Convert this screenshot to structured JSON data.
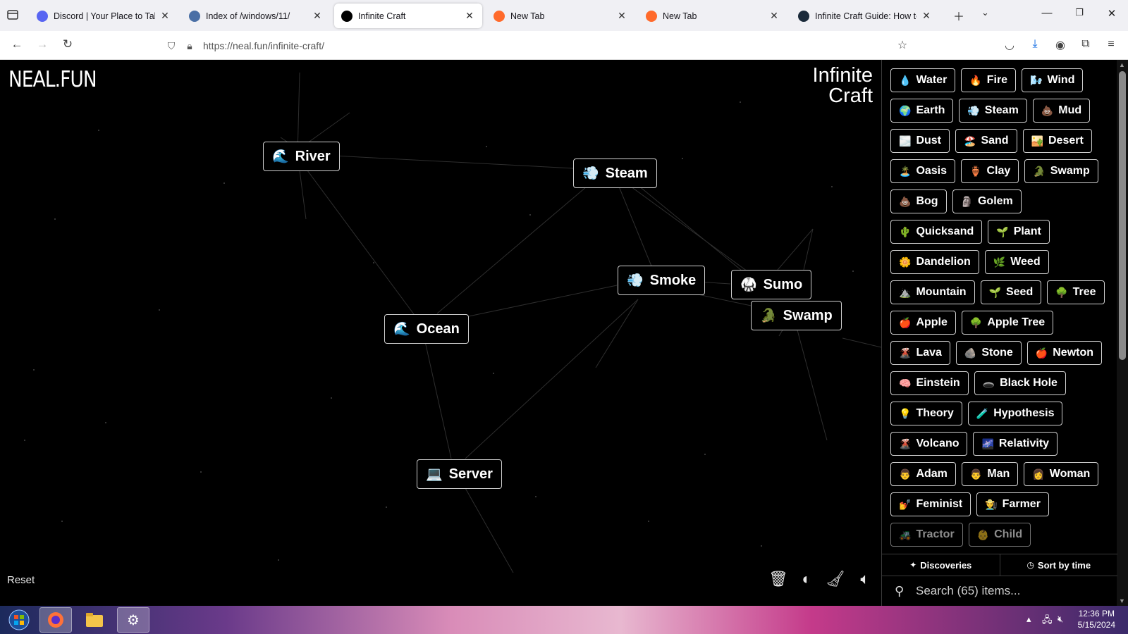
{
  "browser": {
    "tabs": [
      {
        "title": "Discord | Your Place to Talk and",
        "favicon": "discord-icon",
        "color": "#5865f2",
        "active": false
      },
      {
        "title": "Index of /windows/11/",
        "favicon": "page-icon",
        "color": "#4a6fa5",
        "active": false
      },
      {
        "title": "Infinite Craft",
        "favicon": "infinity-icon",
        "color": "#000000",
        "active": true
      },
      {
        "title": "New Tab",
        "favicon": "firefox-icon",
        "color": "#ff6a2b",
        "active": false
      },
      {
        "title": "New Tab",
        "favicon": "firefox-icon",
        "color": "#ff6a2b",
        "active": false
      },
      {
        "title": "Infinite Craft Guide: How to Make",
        "favicon": "article-icon",
        "color": "#1a2a3a",
        "active": false
      }
    ],
    "url": "https://neal.fun/infinite-craft/"
  },
  "canvas": {
    "logo": "NEAL.FUN",
    "brand_line1": "Infinite",
    "brand_line2": "Craft",
    "reset_label": "Reset",
    "nodes": [
      {
        "emoji": "🌊",
        "label": "River"
      },
      {
        "emoji": "💨",
        "label": "Steam"
      },
      {
        "emoji": "💨",
        "label": "Smoke"
      },
      {
        "emoji": "🥋",
        "label": "Sumo"
      },
      {
        "emoji": "🐊",
        "label": "Swamp"
      },
      {
        "emoji": "🌊",
        "label": "Ocean"
      },
      {
        "emoji": "💻",
        "label": "Server"
      }
    ]
  },
  "sidebar": {
    "items": [
      {
        "emoji": "💧",
        "label": "Water"
      },
      {
        "emoji": "🔥",
        "label": "Fire"
      },
      {
        "emoji": "🌬️",
        "label": "Wind"
      },
      {
        "emoji": "🌍",
        "label": "Earth"
      },
      {
        "emoji": "💨",
        "label": "Steam"
      },
      {
        "emoji": "💩",
        "label": "Mud"
      },
      {
        "emoji": "🌫️",
        "label": "Dust"
      },
      {
        "emoji": "🏖️",
        "label": "Sand"
      },
      {
        "emoji": "🏜️",
        "label": "Desert"
      },
      {
        "emoji": "🏝️",
        "label": "Oasis"
      },
      {
        "emoji": "🏺",
        "label": "Clay"
      },
      {
        "emoji": "🐊",
        "label": "Swamp"
      },
      {
        "emoji": "💩",
        "label": "Bog"
      },
      {
        "emoji": "🗿",
        "label": "Golem"
      },
      {
        "emoji": "🌵",
        "label": "Quicksand"
      },
      {
        "emoji": "🌱",
        "label": "Plant"
      },
      {
        "emoji": "🌼",
        "label": "Dandelion"
      },
      {
        "emoji": "🌿",
        "label": "Weed"
      },
      {
        "emoji": "⛰️",
        "label": "Mountain"
      },
      {
        "emoji": "🌱",
        "label": "Seed"
      },
      {
        "emoji": "🌳",
        "label": "Tree"
      },
      {
        "emoji": "🍎",
        "label": "Apple"
      },
      {
        "emoji": "🌳",
        "label": "Apple Tree"
      },
      {
        "emoji": "🌋",
        "label": "Lava"
      },
      {
        "emoji": "🪨",
        "label": "Stone"
      },
      {
        "emoji": "🍎",
        "label": "Newton"
      },
      {
        "emoji": "🧠",
        "label": "Einstein"
      },
      {
        "emoji": "🕳️",
        "label": "Black Hole"
      },
      {
        "emoji": "💡",
        "label": "Theory"
      },
      {
        "emoji": "🧪",
        "label": "Hypothesis"
      },
      {
        "emoji": "🌋",
        "label": "Volcano"
      },
      {
        "emoji": "🌌",
        "label": "Relativity"
      },
      {
        "emoji": "👨",
        "label": "Adam"
      },
      {
        "emoji": "👨",
        "label": "Man"
      },
      {
        "emoji": "👩",
        "label": "Woman"
      },
      {
        "emoji": "💅",
        "label": "Feminist"
      },
      {
        "emoji": "👨‍🌾",
        "label": "Farmer"
      },
      {
        "emoji": "🚜",
        "label": "Tractor"
      },
      {
        "emoji": "👶",
        "label": "Child"
      }
    ],
    "discoveries_label": "Discoveries",
    "sort_label": "Sort by time",
    "search_placeholder": "Search (65) items..."
  },
  "taskbar": {
    "time": "12:36 PM",
    "date": "5/15/2024"
  }
}
